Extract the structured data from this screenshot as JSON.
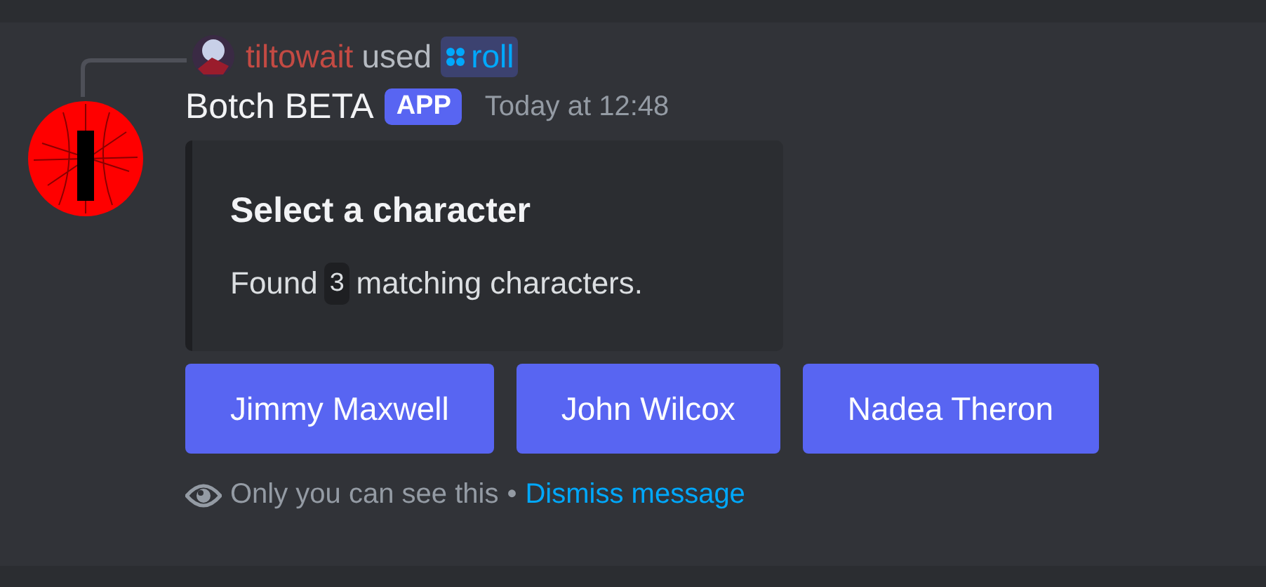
{
  "reply": {
    "user": "tiltowait",
    "verb": "used",
    "command": "roll"
  },
  "message": {
    "author": "Botch BETA",
    "badge": "APP",
    "timestamp": "Today at 12:48"
  },
  "embed": {
    "title": "Select a character",
    "description_before": "Found",
    "count": "3",
    "description_after": "matching characters."
  },
  "buttons": [
    "Jimmy Maxwell",
    "John Wilcox",
    "Nadea Theron"
  ],
  "footer": {
    "notice": "Only you can see this",
    "separator": "•",
    "link": "Dismiss message"
  }
}
